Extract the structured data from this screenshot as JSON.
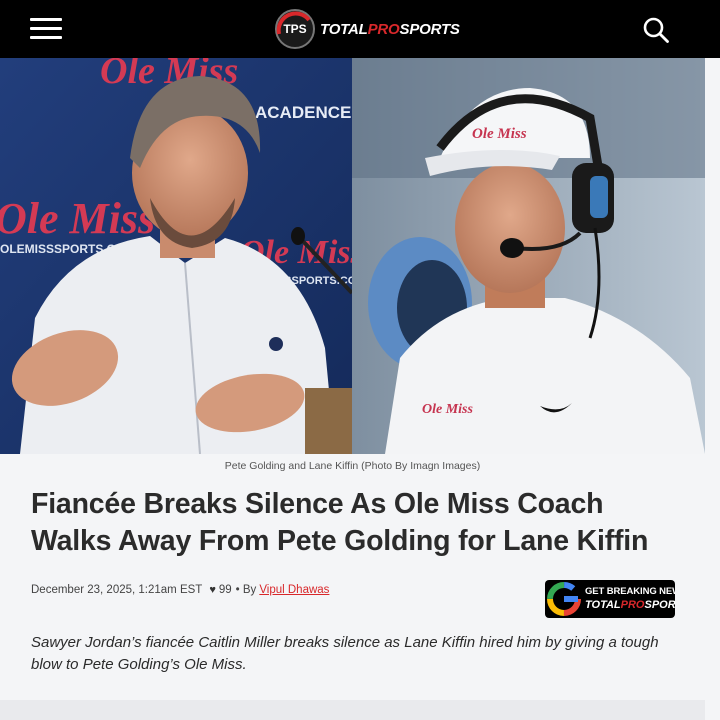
{
  "header": {
    "menu_icon": "hamburger-icon",
    "logo_badge": "TPS",
    "logo_total": "TOTAL",
    "logo_pro": "PRO",
    "logo_sports": "SPORTS",
    "search_icon": "search-icon"
  },
  "hero": {
    "left_backdrop_text": "Ole Miss",
    "left_backdrop_text2": "OLEMISSSPORTS.COM",
    "left_backdrop_text3": "ACADENCE",
    "right_cap_text": "Ole Miss",
    "right_shirt_text": "Ole Miss"
  },
  "article": {
    "caption": "Pete Golding and Lane Kiffin (Photo By Imagn Images)",
    "title": "Fiancée Breaks Silence As Ole Miss Coach Walks Away From Pete Golding for Lane Kiffin",
    "date": "December 23, 2025, 1:21am EST",
    "like_count": "99",
    "by": "• By",
    "author": "Vipul Dhawas",
    "excerpt": "Sawyer Jordan’s fiancée Caitlin Miller breaks silence as Lane Kiffin hired him by giving a tough blow to Pete Golding’s Ole Miss."
  },
  "google_news": {
    "line1": "GET BREAKING NEWS",
    "total": "TOTAL",
    "pro": "PRO",
    "sports": "SPORTS"
  },
  "colors": {
    "brand_red": "#d8282b",
    "header_bg": "#000000",
    "page_bg": "#f4f5f7"
  }
}
